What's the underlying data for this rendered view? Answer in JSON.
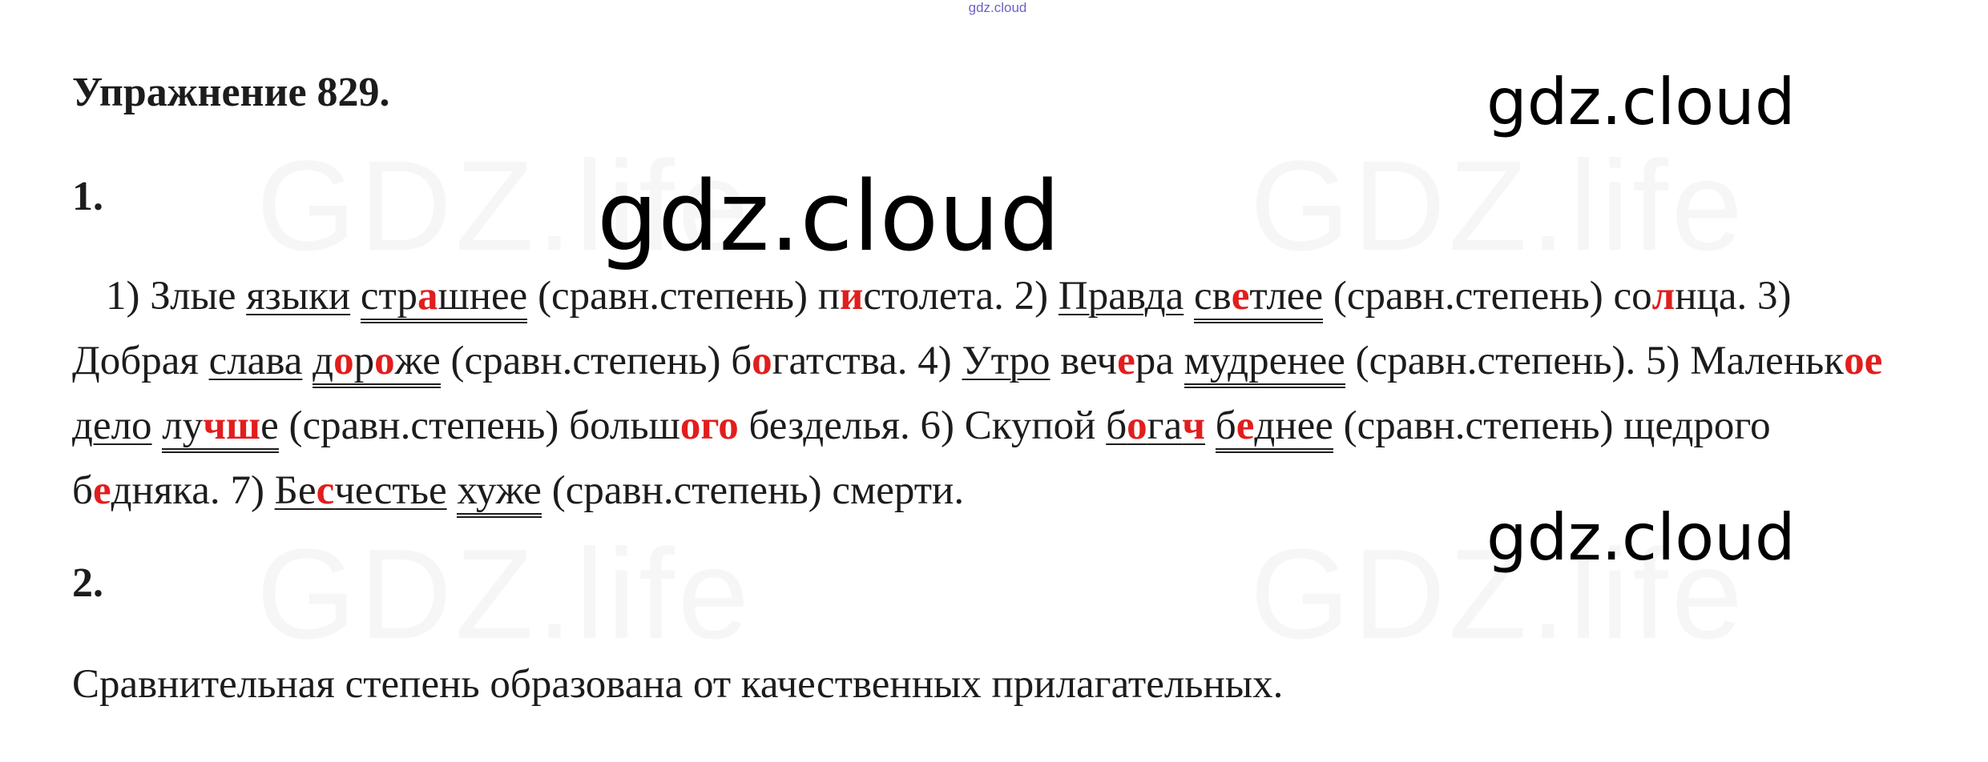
{
  "header": {
    "top_mark": "gdz.cloud"
  },
  "watermark": {
    "text": "GDZ.life"
  },
  "brand": {
    "text": "gdz.cloud"
  },
  "exercise": {
    "title": "Упражнение 829.",
    "part1_number": "1.",
    "part2_number": "2.",
    "term": "сравн.степень",
    "items": {
      "1": {
        "no": "1)",
        "w1": "Злые",
        "subj": "языки",
        "pred_a": "стр",
        "pred_b": "а",
        "pred_c": "шнее",
        "tail_a": "п",
        "tail_b": "и",
        "tail_c": "столета."
      },
      "2": {
        "no": "2)",
        "subj": "Правда",
        "pred_a": "св",
        "pred_b": "е",
        "pred_c": "тлее",
        "tail_a": "со",
        "tail_b": "л",
        "tail_c": "нца."
      },
      "3": {
        "no": "3)",
        "w1": "Добрая",
        "subj": "слава",
        "pred_a": "д",
        "pred_b": "о",
        "pred_c": "р",
        "pred_d": "о",
        "pred_e": "же",
        "tail_a": "б",
        "tail_b": "о",
        "tail_c": "гатства."
      },
      "4": {
        "no": "4)",
        "subj": "Утро",
        "mid_a": "веч",
        "mid_b": "е",
        "mid_c": "ра",
        "pred": "мудренее"
      },
      "5": {
        "no": "5)",
        "adj_a": "Маленьк",
        "adj_b": "ое",
        "subj": "дело",
        "pred_a": "лу",
        "pred_b": "чш",
        "pred_c": "е",
        "tail_a": "больш",
        "tail_b": "ого",
        "tail_c": " безделья."
      },
      "6": {
        "no": "6)",
        "w1": "Скупой",
        "subj_a": "б",
        "subj_b": "о",
        "subj_c": "га",
        "subj_d": "ч",
        "pred_a": "б",
        "pred_b": "е",
        "pred_c": "днее",
        "tail_a": "щедрого б",
        "tail_b": "е",
        "tail_c": "дняка."
      },
      "7": {
        "no": "7)",
        "subj_a": "Бе",
        "subj_b": "с",
        "subj_c": "честье",
        "pred": "хуже",
        "tail": "смерти."
      }
    },
    "conclusion": "Сравнительная степень образована от качественных прилагательных."
  }
}
